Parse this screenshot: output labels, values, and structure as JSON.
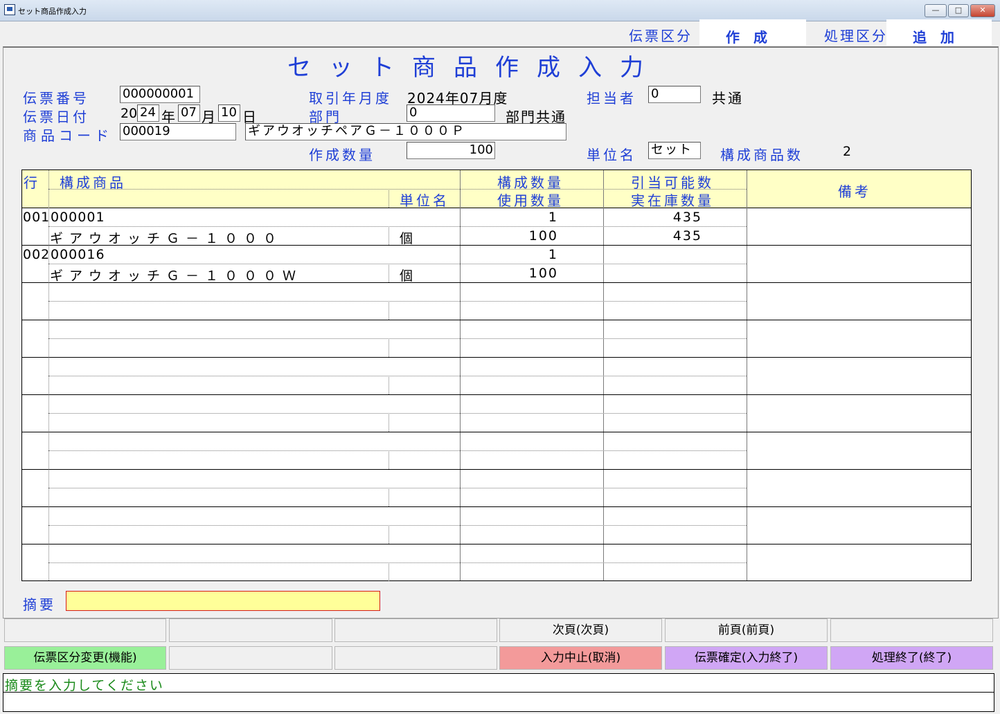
{
  "window": {
    "title": "セット商品作成入力"
  },
  "header": {
    "slip_type_label": "伝票区分",
    "slip_type_value": "作　成",
    "proc_type_label": "処理区分",
    "proc_type_value": "追　加"
  },
  "page_title": "セット商品作成入力",
  "form": {
    "slip_no_label": "伝票番号",
    "slip_no": "000000001",
    "slip_date_label": "伝票日付",
    "year_prefix": "20",
    "year": "24",
    "year_suffix": "年",
    "month": "07",
    "month_suffix": "月",
    "day": "10",
    "day_suffix": "日",
    "product_code_label": "商品コード",
    "product_code": "000019",
    "product_name": "ギアウオッチペアＧ－１０００Ｐ",
    "trade_month_label": "取引年月度",
    "trade_month": "2024年07月度",
    "dept_label": "部門",
    "dept_code": "0",
    "dept_name": "部門共通",
    "qty_label": "作成数量",
    "qty": "100",
    "staff_label": "担当者",
    "staff_code": "0",
    "staff_name": "共通",
    "unit_label": "単位名",
    "unit": "セット",
    "components_label": "構成商品数",
    "components_count": "2"
  },
  "grid": {
    "headers": {
      "row": "行",
      "component": "構成商品",
      "unit": "単位名",
      "comp_qty": "構成数量",
      "use_qty": "使用数量",
      "alloc": "引当可能数",
      "stock": "実在庫数量",
      "remarks": "備考"
    },
    "rows": [
      {
        "no": "001",
        "code": "000001",
        "name": "ギアウオッチＧ－１０００",
        "unit": "個",
        "comp_qty": "1",
        "use_qty": "100",
        "alloc": "435",
        "stock": "435"
      },
      {
        "no": "002",
        "code": "000016",
        "name": "ギアウオッチＧ－１０００Ｗ",
        "unit": "個",
        "comp_qty": "1",
        "use_qty": "100",
        "alloc": "",
        "stock": ""
      }
    ]
  },
  "summary": {
    "label": "摘要",
    "value": ""
  },
  "buttons": {
    "row1": [
      "",
      "",
      "",
      "次頁(次頁)",
      "前頁(前頁)",
      ""
    ],
    "row2": [
      "伝票区分変更(機能)",
      "",
      "",
      "入力中止(取消)",
      "伝票確定(入力終了)",
      "処理終了(終了)"
    ]
  },
  "colors": {
    "green": "#99f099",
    "red": "#f39a9a",
    "purple": "#d0a6f5",
    "yellow": "#ffff99",
    "label_blue": "#1f3fd6"
  },
  "status": {
    "message": "摘要を入力してください"
  }
}
